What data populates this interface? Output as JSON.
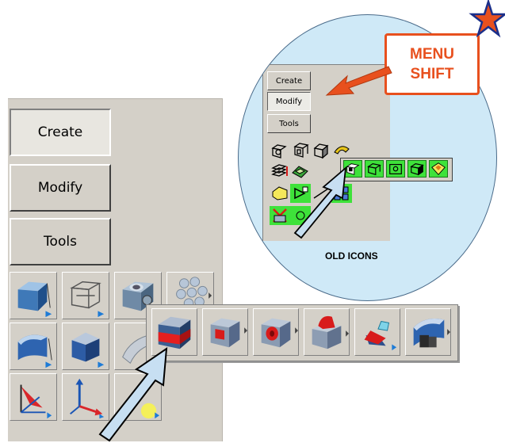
{
  "toolbox": {
    "menu_buttons": [
      {
        "id": "create",
        "label": "Create",
        "state": "pressed"
      },
      {
        "id": "modify",
        "label": "Modify",
        "state": "normal"
      },
      {
        "id": "tools",
        "label": "Tools",
        "state": "normal"
      }
    ],
    "tool_icons": [
      "box-solid-icon",
      "wire-box-icon",
      "hollow-cylinder-icon",
      "array-grid-icon",
      "extrude-blue-icon",
      "chamfer-solid-icon",
      "surface-patch-icon",
      "red-plane-axis-icon",
      "triad-axis-icon",
      "sphere-tool-icon"
    ]
  },
  "flyout": {
    "icons": [
      "partition-box-icon",
      "cutout-box-icon",
      "hole-box-icon",
      "section-cut-icon",
      "plane-cut-icon",
      "extended-cut-icon"
    ]
  },
  "old_ui": {
    "menu_buttons": [
      {
        "id": "create",
        "label": "Create",
        "state": "normal"
      },
      {
        "id": "modify",
        "label": "Modify",
        "state": "pressed"
      },
      {
        "id": "tools",
        "label": "Tools",
        "state": "normal"
      }
    ],
    "caption": "OLD ICONS"
  },
  "callout": {
    "line1": "MENU",
    "line2": "SHIFT"
  },
  "colors": {
    "callout": "#e8501e",
    "inset_bg": "#cfe9f7",
    "old_icon_highlight": "#3ee23a",
    "arrow_fill": "#c7dff2",
    "star": "#e8501e",
    "star_outline": "#1b2f8a"
  }
}
